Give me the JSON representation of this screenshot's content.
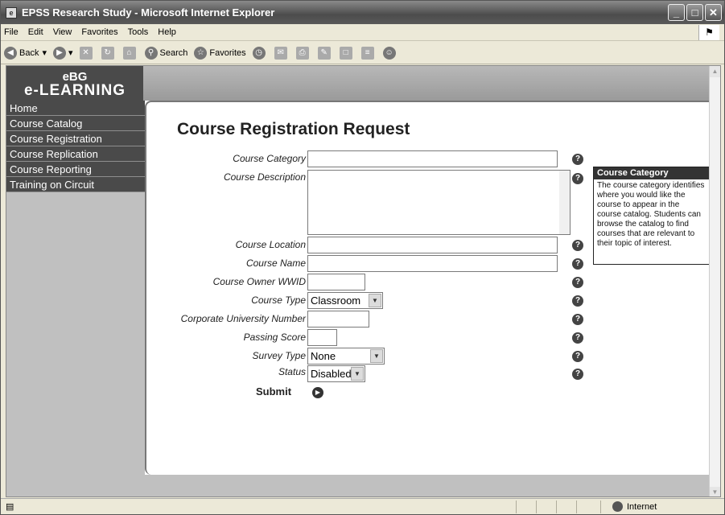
{
  "window": {
    "title": "EPSS Research Study - Microsoft Internet Explorer"
  },
  "menu": [
    "File",
    "Edit",
    "View",
    "Favorites",
    "Tools",
    "Help"
  ],
  "toolbar": {
    "back": "Back",
    "search": "Search",
    "favorites": "Favorites"
  },
  "brand": {
    "line1": "eBG",
    "line2": "e-LEARNING"
  },
  "nav": [
    "Home",
    "Course Catalog",
    "Course Registration",
    "Course Replication",
    "Course Reporting",
    "Training on Circuit"
  ],
  "page": {
    "title": "Course Registration Request"
  },
  "form": {
    "course_category": "Course Category",
    "course_description": "Course Description",
    "course_location": "Course Location",
    "course_name": "Course Name",
    "course_owner_wwid": "Course Owner WWID",
    "course_type": "Course Type",
    "course_type_value": "Classroom",
    "corporate_university_number": "Corporate University Number",
    "passing_score": "Passing Score",
    "survey_type": "Survey Type",
    "survey_type_value": "None",
    "status": "Status",
    "status_value": "Disabled",
    "submit": "Submit"
  },
  "tooltip": {
    "title": "Course Category",
    "body": "The course category identifies where you would like the course to appear in the course catalog. Students can browse the catalog to find courses that are relevant to their topic of interest."
  },
  "status_bar": {
    "zone": "Internet"
  }
}
